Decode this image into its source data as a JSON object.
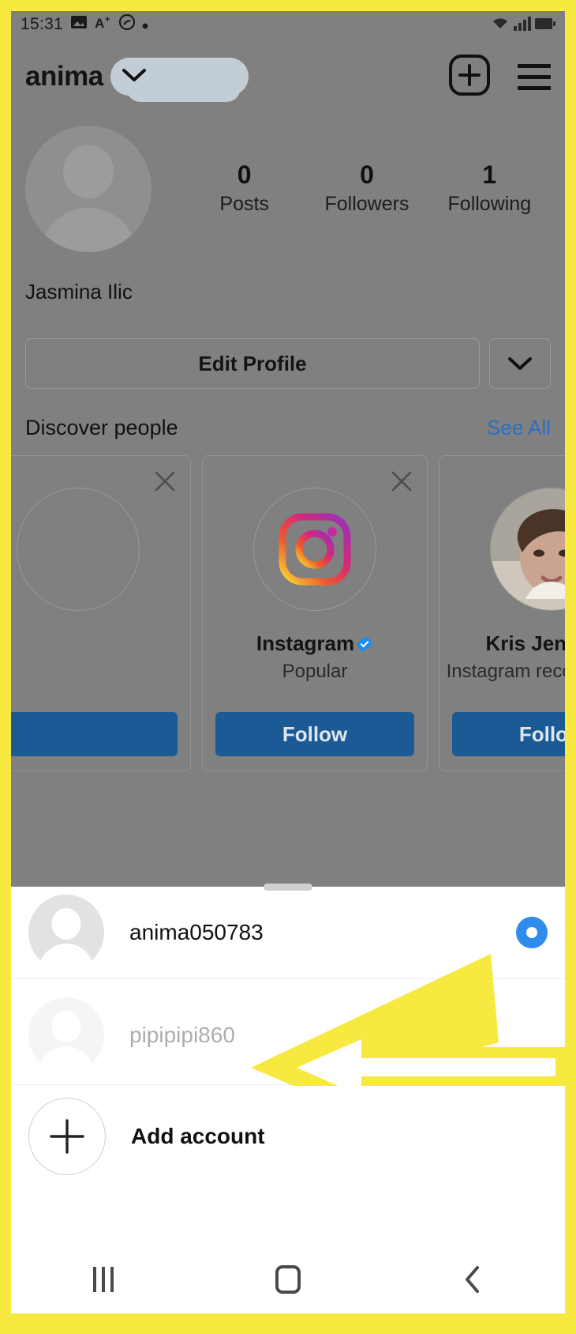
{
  "status_bar": {
    "time": "15:31",
    "left_icons": [
      "image-icon",
      "a-plus-icon",
      "shazam-icon",
      "dot-icon"
    ],
    "right_icons": [
      "wifi-icon",
      "signal-icon",
      "battery-icon"
    ]
  },
  "app_header": {
    "username": "anima",
    "username_redacted": true,
    "chevron_icon": "chevron-down-icon",
    "new_post_icon": "plus-square-icon",
    "menu_icon": "hamburger-menu-icon"
  },
  "profile": {
    "full_name": "Jasmina Ilic",
    "avatar_icon": "default-avatar-icon",
    "stats": [
      {
        "value": "0",
        "label": "Posts"
      },
      {
        "value": "0",
        "label": "Followers"
      },
      {
        "value": "1",
        "label": "Following"
      }
    ],
    "edit_profile_label": "Edit Profile",
    "edit_chevron_icon": "chevron-down-icon"
  },
  "discover": {
    "title": "Discover people",
    "see_all_label": "See All",
    "cards": [
      {
        "name": "",
        "subtitle": "",
        "verified": false,
        "avatar_icon": "default-avatar-icon",
        "follow_label": "",
        "close_icon": "close-icon"
      },
      {
        "name": "Instagram",
        "subtitle": "Popular",
        "verified": true,
        "avatar_icon": "instagram-logo-icon",
        "follow_label": "Follow",
        "close_icon": "close-icon"
      },
      {
        "name": "Kris Jenner",
        "subtitle": "Instagram recommended",
        "verified": true,
        "avatar_icon": "profile-photo",
        "follow_label": "Follow",
        "close_icon": "close-icon"
      }
    ]
  },
  "account_sheet": {
    "grabber_icon": "drag-handle-icon",
    "accounts": [
      {
        "username": "anima050783",
        "selected": true,
        "avatar_icon": "default-avatar-icon"
      },
      {
        "username": "pipipipi860",
        "selected": false,
        "avatar_icon": "default-avatar-icon"
      }
    ],
    "add_account_label": "Add account",
    "add_account_icon": "plus-circle-icon"
  },
  "annotation": {
    "arrow_icon": "left-arrow-annotation",
    "arrow_color": "#f7e93f",
    "points_to": "pipipipi860"
  },
  "nav_bar": {
    "recents_icon": "recents-icon",
    "home_icon": "home-icon",
    "back_icon": "back-icon"
  },
  "colors": {
    "border_highlight": "#f7e93f",
    "dim_overlay": "#808080",
    "follow_button": "#1c5a96",
    "link": "#2b6fc1",
    "radio_selected": "#2f8ced",
    "verified_badge": "#1d8bf0"
  }
}
